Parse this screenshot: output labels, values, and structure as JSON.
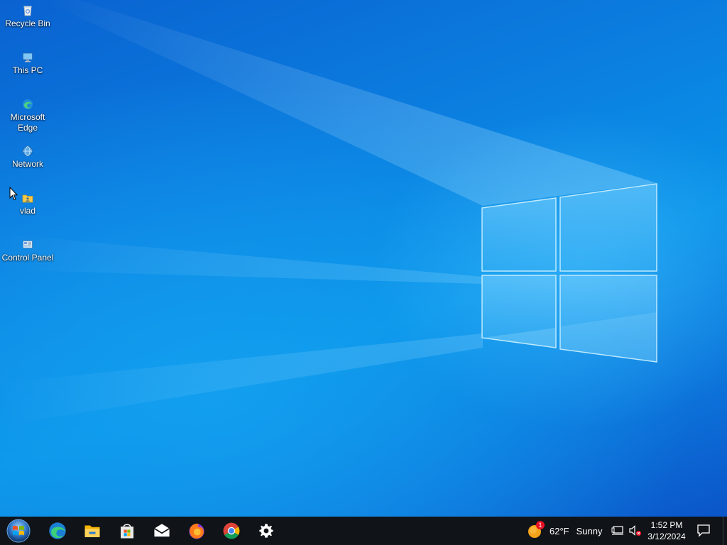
{
  "desktop": {
    "icons": [
      {
        "label": "Recycle Bin",
        "icon": "recycle-bin-icon"
      },
      {
        "label": "This PC",
        "icon": "this-pc-icon"
      },
      {
        "label": "Microsoft\nEdge",
        "icon": "edge-icon"
      },
      {
        "label": "Network",
        "icon": "network-icon"
      },
      {
        "label": "vlad",
        "icon": "user-folder-icon"
      },
      {
        "label": "Control Panel",
        "icon": "control-panel-icon"
      }
    ]
  },
  "taskbar": {
    "start": {
      "icon": "windows-start-icon"
    },
    "pinned": [
      {
        "name": "Microsoft Edge",
        "icon": "edge-icon"
      },
      {
        "name": "File Explorer",
        "icon": "file-explorer-icon"
      },
      {
        "name": "Microsoft Store",
        "icon": "store-icon"
      },
      {
        "name": "Mail",
        "icon": "mail-icon"
      },
      {
        "name": "Firefox",
        "icon": "firefox-icon"
      },
      {
        "name": "Google Chrome",
        "icon": "chrome-icon"
      },
      {
        "name": "Settings",
        "icon": "gear-icon"
      }
    ],
    "weather": {
      "temp": "62°F",
      "condition": "Sunny",
      "badge": "1",
      "icon": "sun-icon"
    },
    "tray_icons": [
      "network-icon",
      "volume-muted-icon"
    ],
    "clock": {
      "time": "1:52 PM",
      "date": "3/12/2024"
    },
    "notifications": {
      "icon": "action-center-icon"
    }
  },
  "colors": {
    "taskbar_bg": "#101418",
    "wallpaper_accent": "#0a78d7",
    "weather_badge": "#e81123"
  }
}
